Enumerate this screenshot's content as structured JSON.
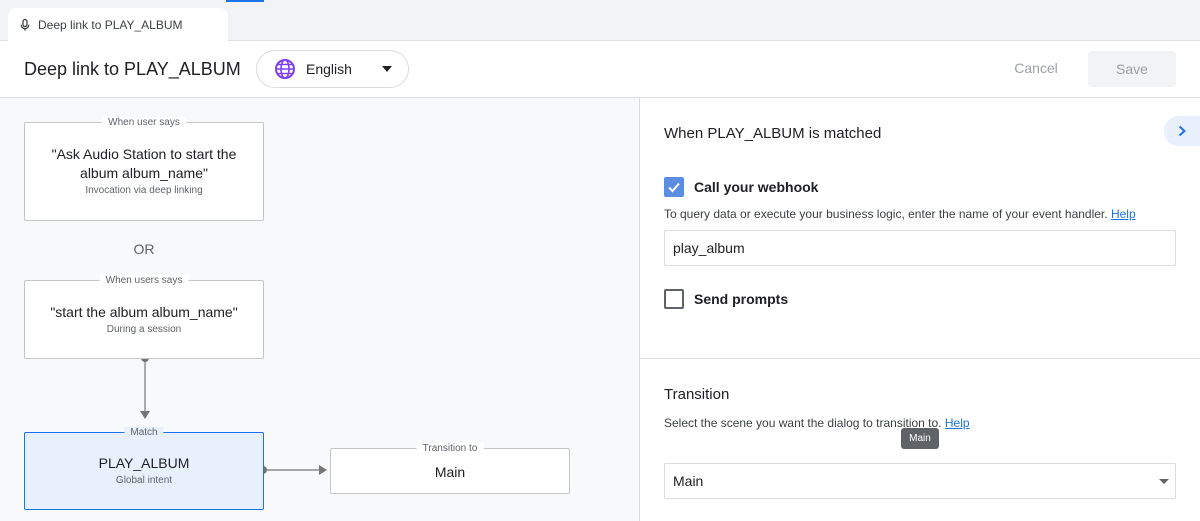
{
  "tab": {
    "title": "Deep link to PLAY_ALBUM",
    "icon": "mic-icon"
  },
  "header": {
    "title": "Deep link to PLAY_ALBUM",
    "language": {
      "icon": "globe-icon",
      "selected": "English"
    },
    "cancel_label": "Cancel",
    "save_label": "Save"
  },
  "flow": {
    "deep_link_node": {
      "caption": "When user says",
      "phrase": "\"Ask Audio Station to start the album album_name\"",
      "subtitle": "Invocation via deep linking"
    },
    "or_label": "OR",
    "session_node": {
      "caption": "When users says",
      "phrase": "\"start the album album_name\"",
      "subtitle": "During a session"
    },
    "match_node": {
      "caption": "Match",
      "intent": "PLAY_ALBUM",
      "subtitle": "Global intent"
    },
    "transition_node": {
      "caption": "Transition to",
      "scene": "Main"
    }
  },
  "panel": {
    "matched_title": "When PLAY_ALBUM is matched",
    "webhook": {
      "label": "Call your webhook",
      "checked": true,
      "help_text": "To query data or execute your business logic, enter the name of your event handler.",
      "help_link": "Help",
      "handler_value": "play_album"
    },
    "prompts": {
      "label": "Send prompts",
      "checked": false
    },
    "transition": {
      "title": "Transition",
      "help_text": "Select the scene you want the dialog to transition to.",
      "help_link": "Help",
      "tooltip": "Main",
      "selected_scene": "Main"
    }
  },
  "colors": {
    "accent": "#1a73e8",
    "match_fill": "#e8f0fe",
    "checkbox_checked": "#5b8de0"
  }
}
